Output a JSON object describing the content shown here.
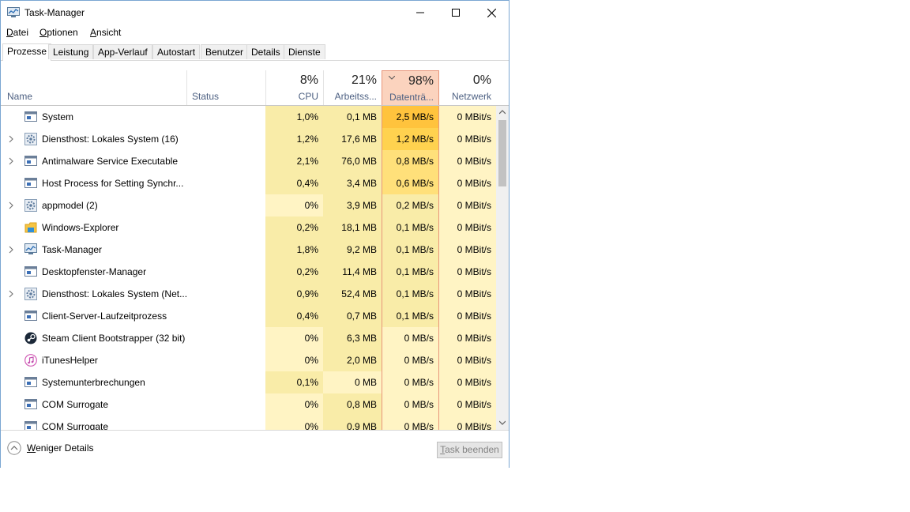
{
  "window": {
    "title": "Task-Manager"
  },
  "menu": [
    {
      "underline": "D",
      "rest": "atei"
    },
    {
      "underline": "O",
      "rest": "ptionen"
    },
    {
      "underline": "A",
      "rest": "nsicht"
    }
  ],
  "tabs": [
    "Prozesse",
    "Leistung",
    "App-Verlauf",
    "Autostart",
    "Benutzer",
    "Details",
    "Dienste"
  ],
  "active_tab": "Prozesse",
  "columns": {
    "name": "Name",
    "status": "Status",
    "cpu": {
      "pct": "8%",
      "label": "CPU"
    },
    "mem": {
      "pct": "21%",
      "label": "Arbeitss..."
    },
    "disk": {
      "pct": "98%",
      "label": "Datenträ..."
    },
    "net": {
      "pct": "0%",
      "label": "Netzwerk"
    }
  },
  "processes": [
    {
      "name": "System",
      "expandable": false,
      "icon": "window-icon",
      "cpu": "1,0%",
      "mem": "0,1 MB",
      "disk": "2,5 MB/s",
      "net": "0 MBit/s"
    },
    {
      "name": "Diensthost: Lokales System (16)",
      "expandable": true,
      "icon": "gear-icon",
      "cpu": "1,2%",
      "mem": "17,6 MB",
      "disk": "1,2 MB/s",
      "net": "0 MBit/s"
    },
    {
      "name": "Antimalware Service Executable",
      "expandable": true,
      "icon": "window-icon",
      "cpu": "2,1%",
      "mem": "76,0 MB",
      "disk": "0,8 MB/s",
      "net": "0 MBit/s"
    },
    {
      "name": "Host Process for Setting Synchr...",
      "expandable": false,
      "icon": "window-icon",
      "cpu": "0,4%",
      "mem": "3,4 MB",
      "disk": "0,6 MB/s",
      "net": "0 MBit/s"
    },
    {
      "name": "appmodel (2)",
      "expandable": true,
      "icon": "gear-icon",
      "cpu": "0%",
      "mem": "3,9 MB",
      "disk": "0,2 MB/s",
      "net": "0 MBit/s"
    },
    {
      "name": "Windows-Explorer",
      "expandable": false,
      "icon": "folder-icon",
      "cpu": "0,2%",
      "mem": "18,1 MB",
      "disk": "0,1 MB/s",
      "net": "0 MBit/s"
    },
    {
      "name": "Task-Manager",
      "expandable": true,
      "icon": "taskmanager-icon",
      "cpu": "1,8%",
      "mem": "9,2 MB",
      "disk": "0,1 MB/s",
      "net": "0 MBit/s"
    },
    {
      "name": "Desktopfenster-Manager",
      "expandable": false,
      "icon": "window-icon",
      "cpu": "0,2%",
      "mem": "11,4 MB",
      "disk": "0,1 MB/s",
      "net": "0 MBit/s"
    },
    {
      "name": "Diensthost: Lokales System (Net...",
      "expandable": true,
      "icon": "gear-icon",
      "cpu": "0,9%",
      "mem": "52,4 MB",
      "disk": "0,1 MB/s",
      "net": "0 MBit/s"
    },
    {
      "name": "Client-Server-Laufzeitprozess",
      "expandable": false,
      "icon": "window-icon",
      "cpu": "0,4%",
      "mem": "0,7 MB",
      "disk": "0,1 MB/s",
      "net": "0 MBit/s"
    },
    {
      "name": "Steam Client Bootstrapper (32 bit)",
      "expandable": false,
      "icon": "steam-icon",
      "cpu": "0%",
      "mem": "6,3 MB",
      "disk": "0 MB/s",
      "net": "0 MBit/s"
    },
    {
      "name": "iTunesHelper",
      "expandable": false,
      "icon": "itunes-icon",
      "cpu": "0%",
      "mem": "2,0 MB",
      "disk": "0 MB/s",
      "net": "0 MBit/s"
    },
    {
      "name": "Systemunterbrechungen",
      "expandable": false,
      "icon": "window-icon",
      "cpu": "0,1%",
      "mem": "0 MB",
      "disk": "0 MB/s",
      "net": "0 MBit/s"
    },
    {
      "name": "COM Surrogate",
      "expandable": false,
      "icon": "window-icon",
      "cpu": "0%",
      "mem": "0,8 MB",
      "disk": "0 MB/s",
      "net": "0 MBit/s"
    },
    {
      "name": "COM Surrogate",
      "expandable": false,
      "icon": "window-icon",
      "cpu": "0%",
      "mem": "0,9 MB",
      "disk": "0 MB/s",
      "net": "0 MBit/s"
    }
  ],
  "footer": {
    "fewer_details_underline": "W",
    "fewer_details_rest": "eniger Details",
    "end_task_underline": "T",
    "end_task_rest": "ask beenden"
  },
  "colors": {
    "heat_low": "#fff4c4",
    "heat_mid": "#f9eca8",
    "disk_high": "#ffd24f",
    "disk_top": "#ffc33d",
    "disk_header": "#fbd3be",
    "disk_border": "#e8957a"
  }
}
